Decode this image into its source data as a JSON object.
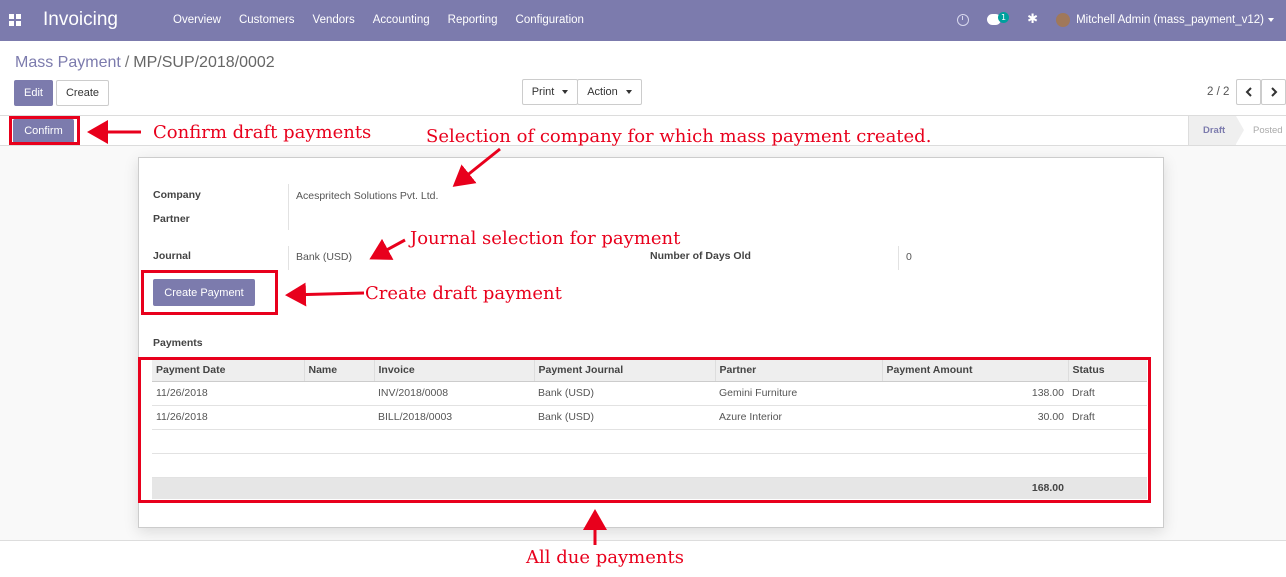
{
  "navbar": {
    "brand": "Invoicing",
    "menu": [
      "Overview",
      "Customers",
      "Vendors",
      "Accounting",
      "Reporting",
      "Configuration"
    ],
    "chat_count": "1",
    "user": "Mitchell Admin (mass_payment_v12)",
    "icons": [
      "apps-icon",
      "clock-icon",
      "chat-icon",
      "bug-icon",
      "avatar"
    ]
  },
  "breadcrumb": {
    "parent": "Mass Payment",
    "separator": "/",
    "current": "MP/SUP/2018/0002"
  },
  "toolbar": {
    "edit": "Edit",
    "create": "Create",
    "print": "Print",
    "action": "Action",
    "pager": "2 / 2"
  },
  "statusbar": {
    "confirm": "Confirm",
    "stages": [
      "Draft",
      "Posted"
    ],
    "active_stage": "Draft"
  },
  "form": {
    "company_label": "Company",
    "company_value": "Acespritech Solutions Pvt. Ltd.",
    "partner_label": "Partner",
    "partner_value": "",
    "journal_label": "Journal",
    "journal_value": "Bank (USD)",
    "days_label": "Number of Days Old",
    "days_value": "0",
    "create_payment": "Create Payment",
    "payments_title": "Payments"
  },
  "table": {
    "headers": [
      "Payment Date",
      "Name",
      "Invoice",
      "Payment Journal",
      "Partner",
      "Payment Amount",
      "Status"
    ],
    "rows": [
      [
        "11/26/2018",
        "",
        "INV/2018/0008",
        "Bank (USD)",
        "Gemini Furniture",
        "138.00",
        "Draft"
      ],
      [
        "11/26/2018",
        "",
        "BILL/2018/0003",
        "Bank (USD)",
        "Azure Interior",
        "30.00",
        "Draft"
      ]
    ],
    "total": "168.00"
  },
  "annotations": {
    "confirm": "Confirm draft payments",
    "company": "Selection of company for which mass payment created.",
    "journal": "Journal selection for payment",
    "create": "Create draft payment",
    "due": "All due payments"
  },
  "colors": {
    "brand": "#7c7bad",
    "annotation": "#e8001c"
  }
}
